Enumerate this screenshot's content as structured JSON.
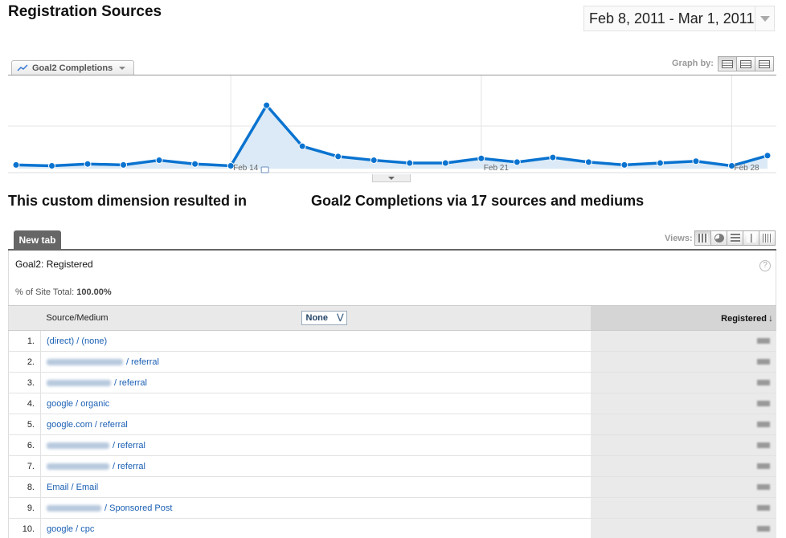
{
  "page": {
    "title": "Registration Sources",
    "date_range": "Feb 8, 2011 - Mar 1, 2011"
  },
  "graph": {
    "metric_tab_label": "Goal2 Completions",
    "graph_by_label": "Graph by:",
    "graph_by_buttons": [
      "day-view-icon",
      "week-view-icon",
      "month-view-icon"
    ],
    "accent_color": "#0a73d0",
    "fill_color": "#dbeaf6"
  },
  "chart_data": {
    "type": "area",
    "series": [
      {
        "values": [
          4,
          3,
          5,
          4,
          9,
          5,
          3,
          68,
          24,
          13,
          9,
          6,
          6,
          11,
          7,
          12,
          7,
          4,
          6,
          8,
          3,
          14
        ]
      }
    ],
    "tick_labels": [
      "Feb 14",
      "Feb 21",
      "Feb 28"
    ],
    "annotation_icon": "comment-icon",
    "grid": true,
    "ylim": [
      0,
      100
    ]
  },
  "summary": {
    "left": "This custom dimension resulted in",
    "right": "Goal2 Completions via 17 sources and mediums"
  },
  "tabs": {
    "new_tab": "New tab"
  },
  "views": {
    "label": "Views:",
    "buttons": [
      "table-view-icon",
      "pie-view-icon",
      "performance-view-icon",
      "comparison-view-icon",
      "pivot-view-icon"
    ]
  },
  "report": {
    "goal_name": "Goal2: Registered",
    "site_total_label": "% of Site Total:",
    "site_total_value": "100.00%",
    "columns": {
      "source": "Source/Medium",
      "secondary": "None",
      "metric": "Registered"
    },
    "rows": [
      {
        "num": "1.",
        "text": "(direct) / (none)",
        "blurred_prefix": false
      },
      {
        "num": "2.",
        "text": "/ referral",
        "blurred_prefix": true,
        "blur_width": 95
      },
      {
        "num": "3.",
        "text": "/ referral",
        "blurred_prefix": true,
        "blur_width": 80
      },
      {
        "num": "4.",
        "text": "google / organic",
        "blurred_prefix": false
      },
      {
        "num": "5.",
        "text": "google.com / referral",
        "blurred_prefix": false
      },
      {
        "num": "6.",
        "text": "/ referral",
        "blurred_prefix": true,
        "blur_width": 78
      },
      {
        "num": "7.",
        "text": "/ referral",
        "blurred_prefix": true,
        "blur_width": 78
      },
      {
        "num": "8.",
        "text": "Email / Email",
        "blurred_prefix": false
      },
      {
        "num": "9.",
        "text": "/ Sponsored Post",
        "blurred_prefix": true,
        "blur_width": 68
      },
      {
        "num": "10.",
        "text": "google / cpc",
        "blurred_prefix": false
      }
    ]
  }
}
